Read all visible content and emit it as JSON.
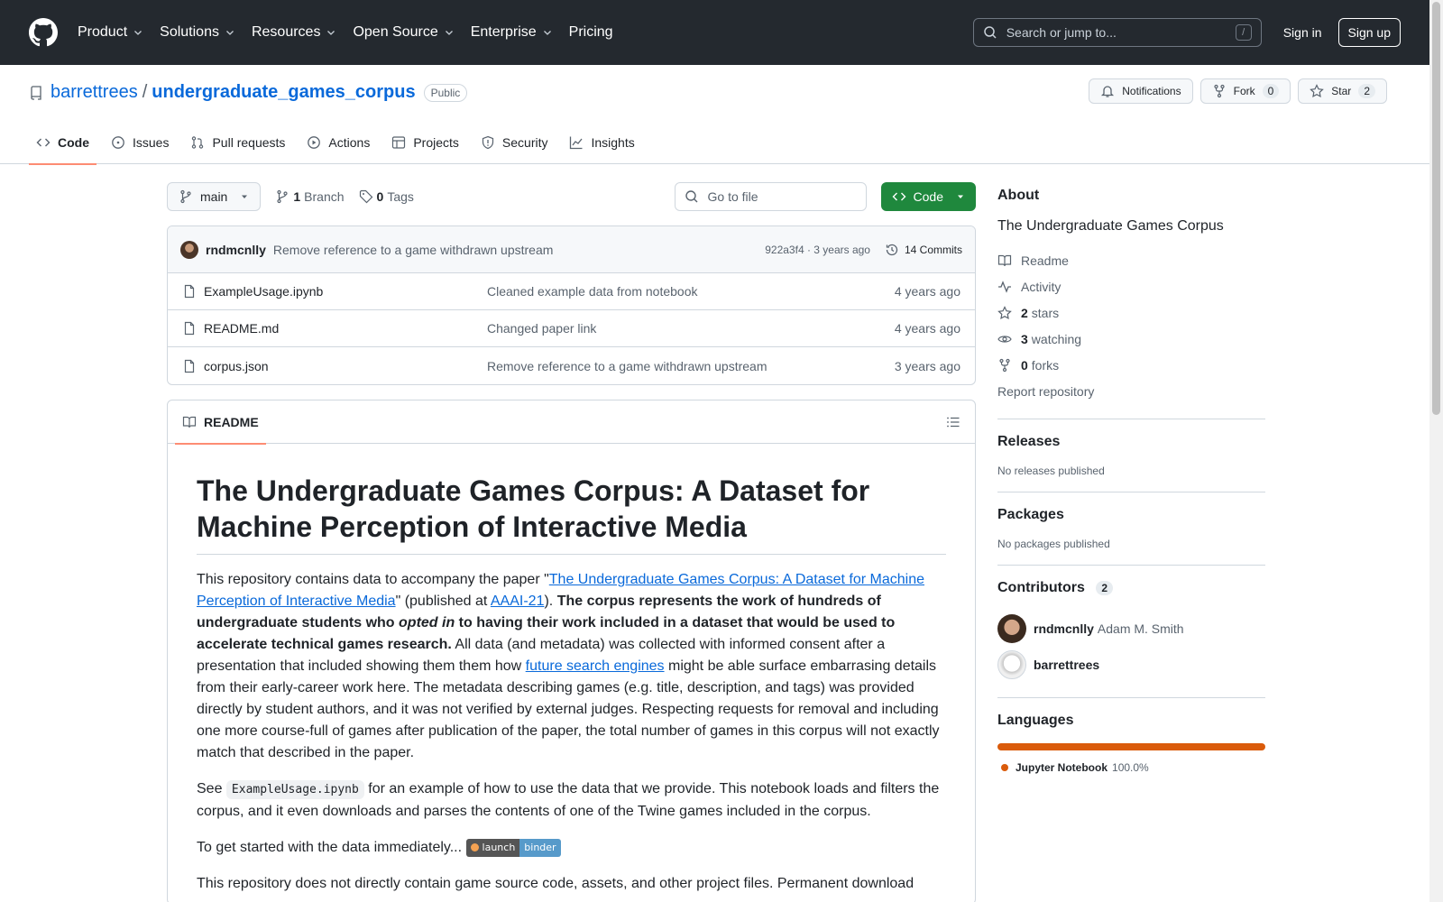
{
  "header": {
    "nav": [
      "Product",
      "Solutions",
      "Resources",
      "Open Source",
      "Enterprise",
      "Pricing"
    ],
    "search_placeholder": "Search or jump to...",
    "search_key": "/",
    "sign_in": "Sign in",
    "sign_up": "Sign up"
  },
  "repo": {
    "owner": "barrettrees",
    "separator": "/",
    "name": "undergraduate_games_corpus",
    "visibility": "Public",
    "notifications_label": "Notifications",
    "fork_label": "Fork",
    "fork_count": "0",
    "star_label": "Star",
    "star_count": "2"
  },
  "tabs": [
    "Code",
    "Issues",
    "Pull requests",
    "Actions",
    "Projects",
    "Security",
    "Insights"
  ],
  "filebar": {
    "branch": "main",
    "branch_count": "1",
    "branch_label": "Branch",
    "tag_count": "0",
    "tag_label": "Tags",
    "goto_placeholder": "Go to file",
    "code_button": "Code"
  },
  "commit": {
    "author": "rndmcnlly",
    "message": "Remove reference to a game withdrawn upstream",
    "meta": "922a3f4 · 3 years ago",
    "commits": "14 Commits"
  },
  "files": [
    {
      "name": "ExampleUsage.ipynb",
      "message": "Cleaned example data from notebook",
      "age": "4 years ago"
    },
    {
      "name": "README.md",
      "message": "Changed paper link",
      "age": "4 years ago"
    },
    {
      "name": "corpus.json",
      "message": "Remove reference to a game withdrawn upstream",
      "age": "3 years ago"
    }
  ],
  "readme": {
    "tab": "README",
    "title": "The Undergraduate Games Corpus: A Dataset for Machine Perception of Interactive Media",
    "p1_a": "This repository contains data to accompany the paper \"",
    "p1_link1": "The Undergraduate Games Corpus: A Dataset for Machine Perception of Interactive Media",
    "p1_b": "\" (published at ",
    "p1_link2": "AAAI-21",
    "p1_c": "). ",
    "p1_bold1": "The corpus represents the work of hundreds of undergraduate students who ",
    "p1_em": "opted in",
    "p1_bold2": " to having their work included in a dataset that would be used to accelerate technical games research.",
    "p1_d": " All data (and metadata) was collected with informed consent after a presentation that included showing them them how ",
    "p1_link3": "future search engines",
    "p1_e": " might be able surface embarrasing details from their early-career work here. The metadata describing games (e.g. title, description, and tags) was provided directly by student authors, and it was not verified by external judges. Respecting requests for removal and including one more course-full of games after publication of the paper, the total number of games in this corpus will not exactly match that described in the paper.",
    "p2_a": "See ",
    "p2_code": "ExampleUsage.ipynb",
    "p2_b": " for an example of how to use the data that we provide. This notebook loads and filters the corpus, and it even downloads and parses the contents of one of the Twine games included in the corpus.",
    "p3": "To get started with the data immediately...",
    "badge_left": "launch",
    "badge_right": "binder",
    "p4": "This repository does not directly contain game source code, assets, and other project files. Permanent download"
  },
  "sidebar": {
    "about_title": "About",
    "about_desc": "The Undergraduate Games Corpus",
    "readme": "Readme",
    "activity": "Activity",
    "stars_count": "2",
    "stars_label": "stars",
    "watching_count": "3",
    "watching_label": "watching",
    "forks_count": "0",
    "forks_label": "forks",
    "report": "Report repository",
    "releases_title": "Releases",
    "releases_empty": "No releases published",
    "packages_title": "Packages",
    "packages_empty": "No packages published",
    "contributors_title": "Contributors",
    "contributors_count": "2",
    "contributors": [
      {
        "login": "rndmcnlly",
        "name": "Adam M. Smith"
      },
      {
        "login": "barrettrees",
        "name": ""
      }
    ],
    "languages_title": "Languages",
    "language": "Jupyter Notebook",
    "language_pct": "100.0%"
  },
  "colors": {
    "header_bg": "#24292f",
    "link": "#0969da",
    "code_button": "#1f883d",
    "tab_underline": "#fd8c73",
    "jupyter": "#da5b0b"
  }
}
